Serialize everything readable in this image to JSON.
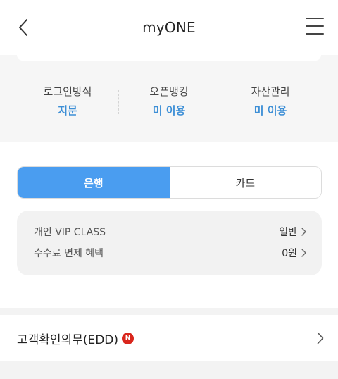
{
  "header": {
    "title": "myONE",
    "back_icon": "chevron-left-icon",
    "menu_icon": "hamburger-menu-icon"
  },
  "stats": [
    {
      "label": "로그인방식",
      "value": "지문"
    },
    {
      "label": "오픈뱅킹",
      "value": "미 이용"
    },
    {
      "label": "자산관리",
      "value": "미 이용"
    }
  ],
  "tabs": [
    {
      "label": "은행",
      "active": true
    },
    {
      "label": "카드",
      "active": false
    }
  ],
  "info": {
    "vip_label": "개인 VIP CLASS",
    "vip_value": "일반",
    "fee_label": "수수료 면제 혜택",
    "fee_value": "0원"
  },
  "edd": {
    "label": "고객확인의무(EDD)",
    "badge": "N"
  },
  "colors": {
    "accent": "#4a9df0",
    "value_blue": "#3d8fd6",
    "badge_red": "#d9261c"
  }
}
